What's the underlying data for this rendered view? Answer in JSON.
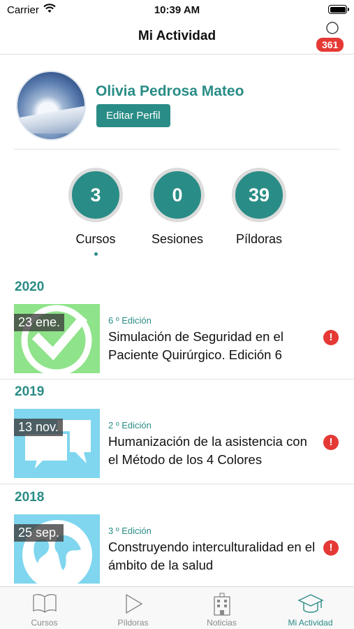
{
  "status_bar": {
    "carrier": "Carrier",
    "time": "10:39 AM"
  },
  "header": {
    "title": "Mi Actividad",
    "notification_count": "361"
  },
  "profile": {
    "name": "Olivia Pedrosa Mateo",
    "edit_label": "Editar Perfil"
  },
  "stats": [
    {
      "value": "3",
      "label": "Cursos"
    },
    {
      "value": "0",
      "label": "Sesiones"
    },
    {
      "value": "39",
      "label": "Píldoras"
    }
  ],
  "years": [
    "2020",
    "2019",
    "2018"
  ],
  "courses": [
    {
      "date": "23 ene.",
      "edition": "6 º Edición",
      "title": "Simulación de Seguridad en el Paciente Quirúrgico. Edición 6",
      "thumb_color": "#8fe38a",
      "icon": "checkmark-icon"
    },
    {
      "date": "13 nov.",
      "edition": "2 º Edición",
      "title": "Humanización de la asistencia con el Método de los 4 Colores",
      "thumb_color": "#7fd6ee",
      "icon": "chat-bubbles-icon"
    },
    {
      "date": "25 sep.",
      "edition": "3 º Edición",
      "title": "Construyendo interculturalidad en el ámbito de la salud",
      "thumb_color": "#7fd6ee",
      "icon": "globe-icon"
    }
  ],
  "tabs": [
    {
      "label": "Cursos",
      "icon": "book-icon"
    },
    {
      "label": "Píldoras",
      "icon": "play-icon"
    },
    {
      "label": "Noticias",
      "icon": "building-icon"
    },
    {
      "label": "Mi Actividad",
      "icon": "graduation-cap-icon"
    }
  ],
  "colors": {
    "accent": "#2a8c86",
    "alert": "#e53935"
  }
}
